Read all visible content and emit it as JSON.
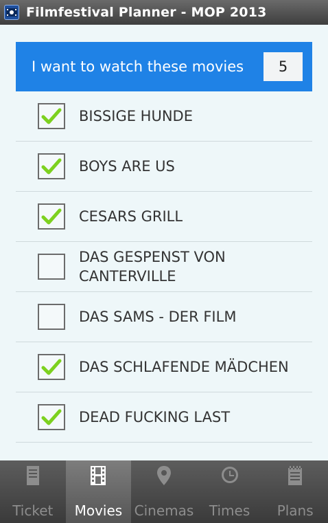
{
  "app": {
    "title": "Filmfestival Planner - MOP 2013"
  },
  "header": {
    "label": "I want to watch these movies",
    "count": "5"
  },
  "movies": [
    {
      "title": "BISSIGE HUNDE",
      "checked": true
    },
    {
      "title": "BOYS ARE US",
      "checked": true
    },
    {
      "title": "CESARS GRILL",
      "checked": true
    },
    {
      "title": "DAS GESPENST VON CANTERVILLE",
      "checked": false
    },
    {
      "title": "DAS SAMS - DER FILM",
      "checked": false
    },
    {
      "title": "DAS SCHLAFENDE MÄDCHEN",
      "checked": true
    },
    {
      "title": "DEAD FUCKING LAST",
      "checked": true
    }
  ],
  "tabs": [
    {
      "label": "Ticket",
      "icon": "ticket-icon",
      "active": false
    },
    {
      "label": "Movies",
      "icon": "film-icon",
      "active": true
    },
    {
      "label": "Cinemas",
      "icon": "location-pin-icon",
      "active": false
    },
    {
      "label": "Times",
      "icon": "clock-icon",
      "active": false
    },
    {
      "label": "Plans",
      "icon": "notepad-icon",
      "active": false
    }
  ],
  "colors": {
    "accent": "#1f82e6",
    "check": "#7dd11f"
  }
}
